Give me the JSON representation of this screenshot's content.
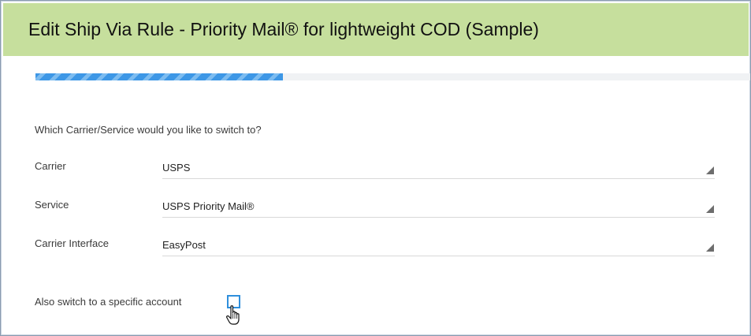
{
  "dialog": {
    "title": "Edit Ship Via Rule - Priority Mail® for lightweight COD (Sample)"
  },
  "progress": {
    "fraction": 0.346
  },
  "form": {
    "prompt": "Which Carrier/Service would you like to switch to?",
    "fields": [
      {
        "label": "Carrier",
        "value": "USPS"
      },
      {
        "label": "Service",
        "value": "USPS Priority Mail®"
      },
      {
        "label": "Carrier Interface",
        "value": "EasyPost"
      }
    ],
    "account_switch": {
      "label": "Also switch to a specific account",
      "checked": false
    }
  },
  "icons": {
    "dropdown": "dropdown-triangle-icon",
    "cursor": "hand-pointer-icon"
  },
  "colors": {
    "header_bg": "#c6df9d",
    "progress_stripe": "#3d97e6",
    "checkbox_border": "#2f8fdc"
  }
}
